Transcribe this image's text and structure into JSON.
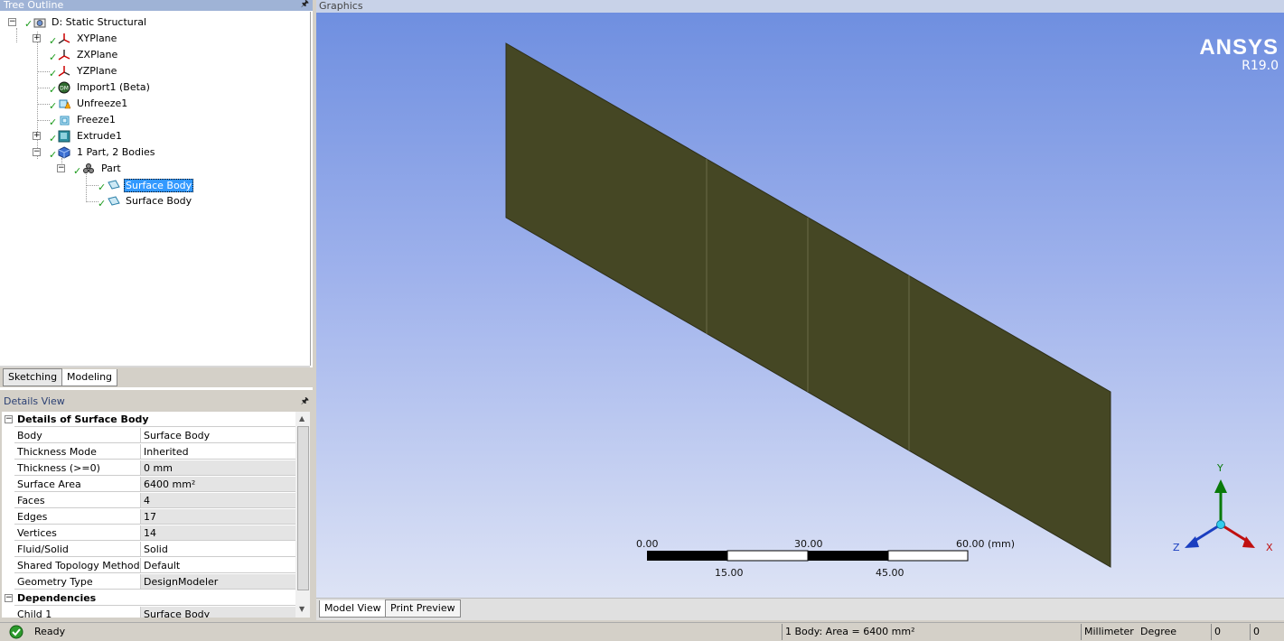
{
  "tree": {
    "title": "Tree Outline",
    "items": [
      {
        "label": "D: Static Structural"
      },
      {
        "label": "XYPlane"
      },
      {
        "label": "ZXPlane"
      },
      {
        "label": "YZPlane"
      },
      {
        "label": "Import1 (Beta)"
      },
      {
        "label": "Unfreeze1"
      },
      {
        "label": "Freeze1"
      },
      {
        "label": "Extrude1"
      },
      {
        "label": "1 Part, 2 Bodies"
      },
      {
        "label": "Part"
      },
      {
        "label": "Surface Body",
        "selected": true
      },
      {
        "label": "Surface Body"
      }
    ],
    "tabs": [
      "Sketching",
      "Modeling"
    ],
    "active_tab": "Modeling"
  },
  "details": {
    "title": "Details View",
    "group1": "Details of Surface Body",
    "rows": [
      {
        "name": "Body",
        "value": "Surface Body"
      },
      {
        "name": "Thickness Mode",
        "value": "Inherited"
      },
      {
        "name": "Thickness (>=0)",
        "value": "0 mm"
      },
      {
        "name": "Surface Area",
        "value": "6400 mm²"
      },
      {
        "name": "Faces",
        "value": "4"
      },
      {
        "name": "Edges",
        "value": "17"
      },
      {
        "name": "Vertices",
        "value": "14"
      },
      {
        "name": "Fluid/Solid",
        "value": "Solid"
      },
      {
        "name": "Shared Topology Method",
        "value": "Default"
      },
      {
        "name": "Geometry Type",
        "value": "DesignModeler"
      }
    ],
    "group2": "Dependencies",
    "dep_rows": [
      {
        "name": "Child 1",
        "value": "Surface Body"
      }
    ]
  },
  "graphics": {
    "title": "Graphics",
    "brand": "ANSYS",
    "version": "R19.0",
    "scale": {
      "top_labels": [
        "0.00",
        "30.00",
        "60.00 (mm)"
      ],
      "bottom_labels": [
        "15.00",
        "45.00"
      ]
    },
    "axes": {
      "y": "Y",
      "x": "X",
      "z": "Z"
    },
    "tabs": [
      "Model View",
      "Print Preview"
    ],
    "active_tab": "Model View",
    "surface_color": "#454724"
  },
  "status": {
    "message": "Ready",
    "selection": "1 Body: Area = 6400 mm²",
    "length_unit": "Millimeter",
    "angle_unit": "Degree",
    "field1": "0",
    "field2": "0"
  }
}
